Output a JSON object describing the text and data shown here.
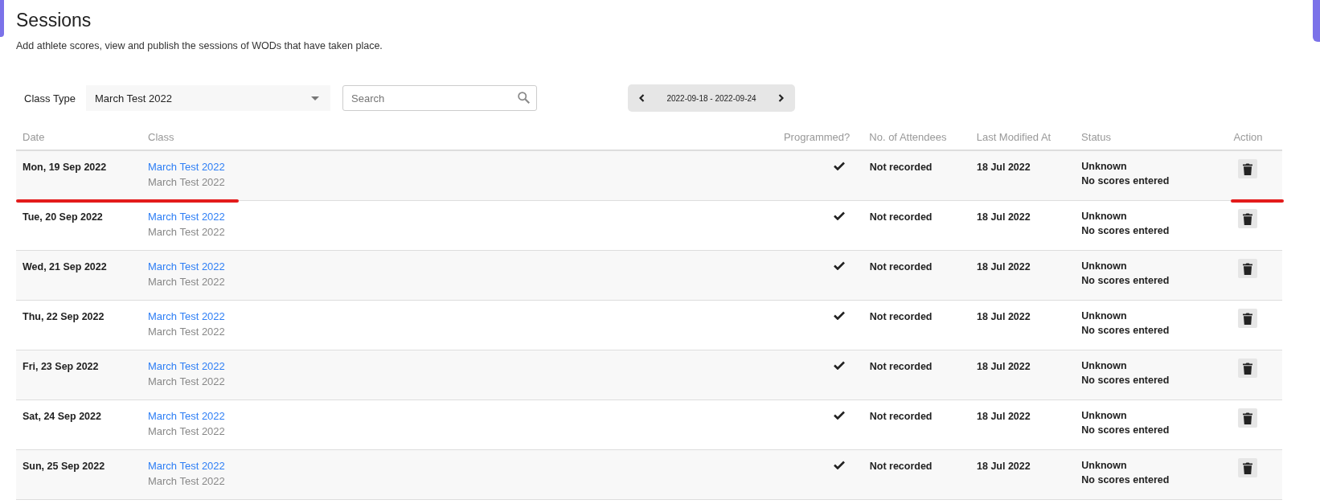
{
  "page": {
    "title": "Sessions",
    "subtitle": "Add athlete scores, view and publish the sessions of WODs that have taken place."
  },
  "filters": {
    "class_type_label": "Class Type",
    "class_type_value": "March Test 2022",
    "search_placeholder": "Search",
    "week_range": "2022-09-18 - 2022-09-24"
  },
  "table": {
    "columns": [
      "Date",
      "Class",
      "Programmed?",
      "No. of Attendees",
      "Last Modified At",
      "Status",
      "Action"
    ],
    "rows": [
      {
        "date": "Mon, 19 Sep 2022",
        "class": "March Test 2022",
        "class_type": "March Test 2022",
        "programmed": true,
        "attendees": "Not recorded",
        "modified": "18 Jul 2022",
        "status": "Unknown",
        "scores": "No scores entered",
        "highlighted": true
      },
      {
        "date": "Tue, 20 Sep 2022",
        "class": "March Test 2022",
        "class_type": "March Test 2022",
        "programmed": true,
        "attendees": "Not recorded",
        "modified": "18 Jul 2022",
        "status": "Unknown",
        "scores": "No scores entered",
        "highlighted": false
      },
      {
        "date": "Wed, 21 Sep 2022",
        "class": "March Test 2022",
        "class_type": "March Test 2022",
        "programmed": true,
        "attendees": "Not recorded",
        "modified": "18 Jul 2022",
        "status": "Unknown",
        "scores": "No scores entered",
        "highlighted": false
      },
      {
        "date": "Thu, 22 Sep 2022",
        "class": "March Test 2022",
        "class_type": "March Test 2022",
        "programmed": true,
        "attendees": "Not recorded",
        "modified": "18 Jul 2022",
        "status": "Unknown",
        "scores": "No scores entered",
        "highlighted": false
      },
      {
        "date": "Fri, 23 Sep 2022",
        "class": "March Test 2022",
        "class_type": "March Test 2022",
        "programmed": true,
        "attendees": "Not recorded",
        "modified": "18 Jul 2022",
        "status": "Unknown",
        "scores": "No scores entered",
        "highlighted": false
      },
      {
        "date": "Sat, 24 Sep 2022",
        "class": "March Test 2022",
        "class_type": "March Test 2022",
        "programmed": true,
        "attendees": "Not recorded",
        "modified": "18 Jul 2022",
        "status": "Unknown",
        "scores": "No scores entered",
        "highlighted": false
      },
      {
        "date": "Sun, 25 Sep 2022",
        "class": "March Test 2022",
        "class_type": "March Test 2022",
        "programmed": true,
        "attendees": "Not recorded",
        "modified": "18 Jul 2022",
        "status": "Unknown",
        "scores": "No scores entered",
        "highlighted": false
      }
    ]
  }
}
